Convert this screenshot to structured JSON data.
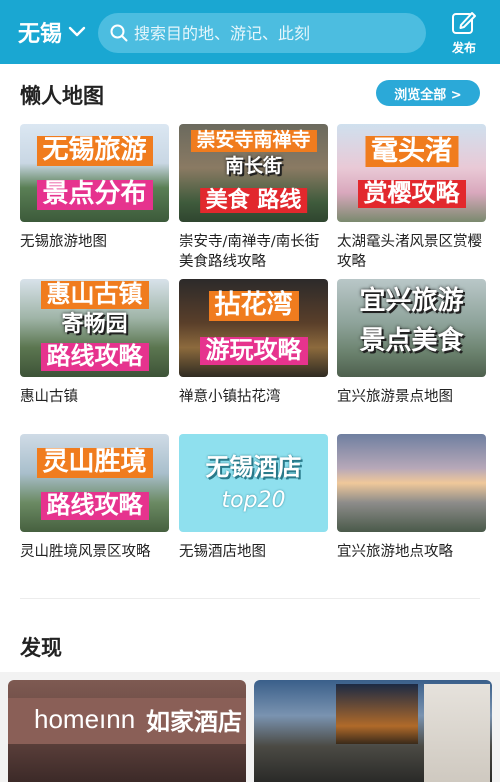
{
  "header": {
    "city": "无锡",
    "search_placeholder": "搜索目的地、游记、此刻",
    "publish_label": "发布"
  },
  "lazy_map": {
    "title": "懒人地图",
    "browse_all": "浏览全部 >",
    "cards": [
      {
        "caption": "无锡旅游地图",
        "tags": [
          "无锡旅游",
          "景点分布"
        ]
      },
      {
        "caption": "崇安寺/南禅寺/南长街美食路线攻略",
        "tags": [
          "崇安寺南禅寺",
          "南长街",
          "美食 路线"
        ]
      },
      {
        "caption": "太湖鼋头渚风景区赏樱攻略",
        "tags": [
          "鼋头渚",
          "赏樱攻略"
        ]
      },
      {
        "caption": "惠山古镇",
        "tags": [
          "惠山古镇",
          "寄畅园",
          "路线攻略"
        ]
      },
      {
        "caption": "禅意小镇拈花湾",
        "tags": [
          "拈花湾",
          "游玩攻略"
        ]
      },
      {
        "caption": "宜兴旅游景点地图",
        "tags": [
          "宜兴旅游",
          "景点美食"
        ]
      },
      {
        "caption": "灵山胜境风景区攻略",
        "tags": [
          "灵山胜境",
          "路线攻略"
        ]
      },
      {
        "caption": "无锡酒店地图",
        "tags": [
          "无锡酒店",
          "top20"
        ]
      },
      {
        "caption": "宜兴旅游地点攻略",
        "tags": []
      }
    ]
  },
  "discover": {
    "title": "发现",
    "feed": [
      {
        "sign_en": "homeınn",
        "sign_cn": "如家酒店"
      },
      {
        "sign_cn": ""
      }
    ]
  },
  "colors": {
    "header": "#1aa7d2",
    "search_bg": "#4cbde0",
    "tag_orange": "#f07c1e",
    "tag_pink": "#e6338e",
    "tag_red": "#e2282d"
  }
}
